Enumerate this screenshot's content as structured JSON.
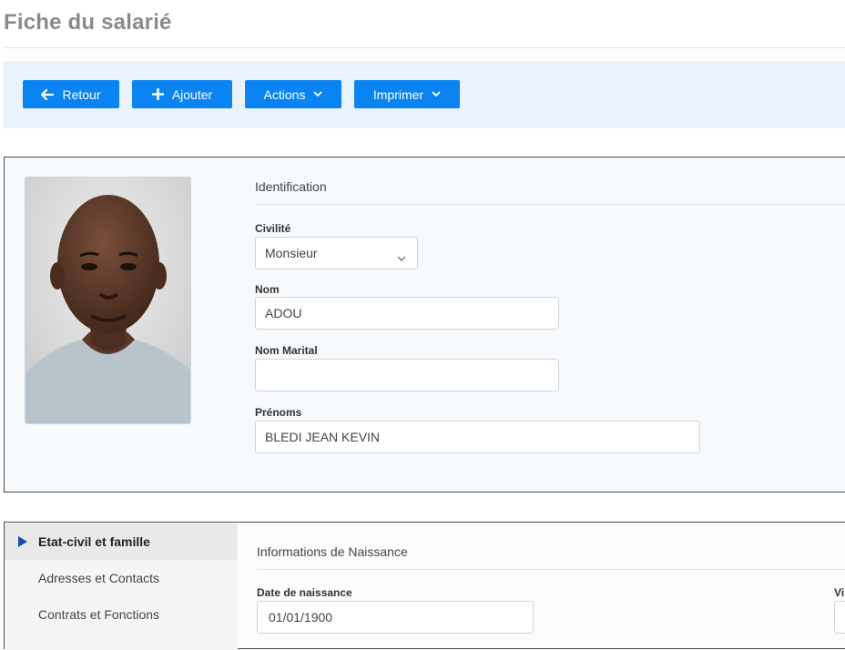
{
  "page": {
    "title": "Fiche du salarié"
  },
  "toolbar": {
    "back_label": "Retour",
    "add_label": "Ajouter",
    "actions_label": "Actions",
    "print_label": "Imprimer"
  },
  "identification": {
    "section_title": "Identification",
    "civilite": {
      "label": "Civilité",
      "value": "Monsieur"
    },
    "nom": {
      "label": "Nom",
      "value": "ADOU"
    },
    "nom_marital": {
      "label": "Nom Marital",
      "value": ""
    },
    "prenoms": {
      "label": "Prénoms",
      "value": "BLEDI JEAN KEVIN"
    }
  },
  "sidebar": {
    "items": [
      {
        "label": "Etat-civil et famille",
        "active": true
      },
      {
        "label": "Adresses et Contacts"
      },
      {
        "label": "Contrats et Fonctions"
      }
    ]
  },
  "naissance": {
    "section_title": "Informations de Naissance",
    "date": {
      "label": "Date de naissance",
      "value": "01/01/1900"
    },
    "ville": {
      "label": "Vi"
    }
  },
  "colors": {
    "primary": "#0a84f0",
    "toolbar_bg": "#eaf3fd",
    "active_arrow": "#1a4fa8"
  },
  "icons": {
    "back": "arrow-left-icon",
    "add": "plus-icon",
    "dropdown": "chevron-down-icon",
    "nav_active": "triangle-right-icon"
  }
}
